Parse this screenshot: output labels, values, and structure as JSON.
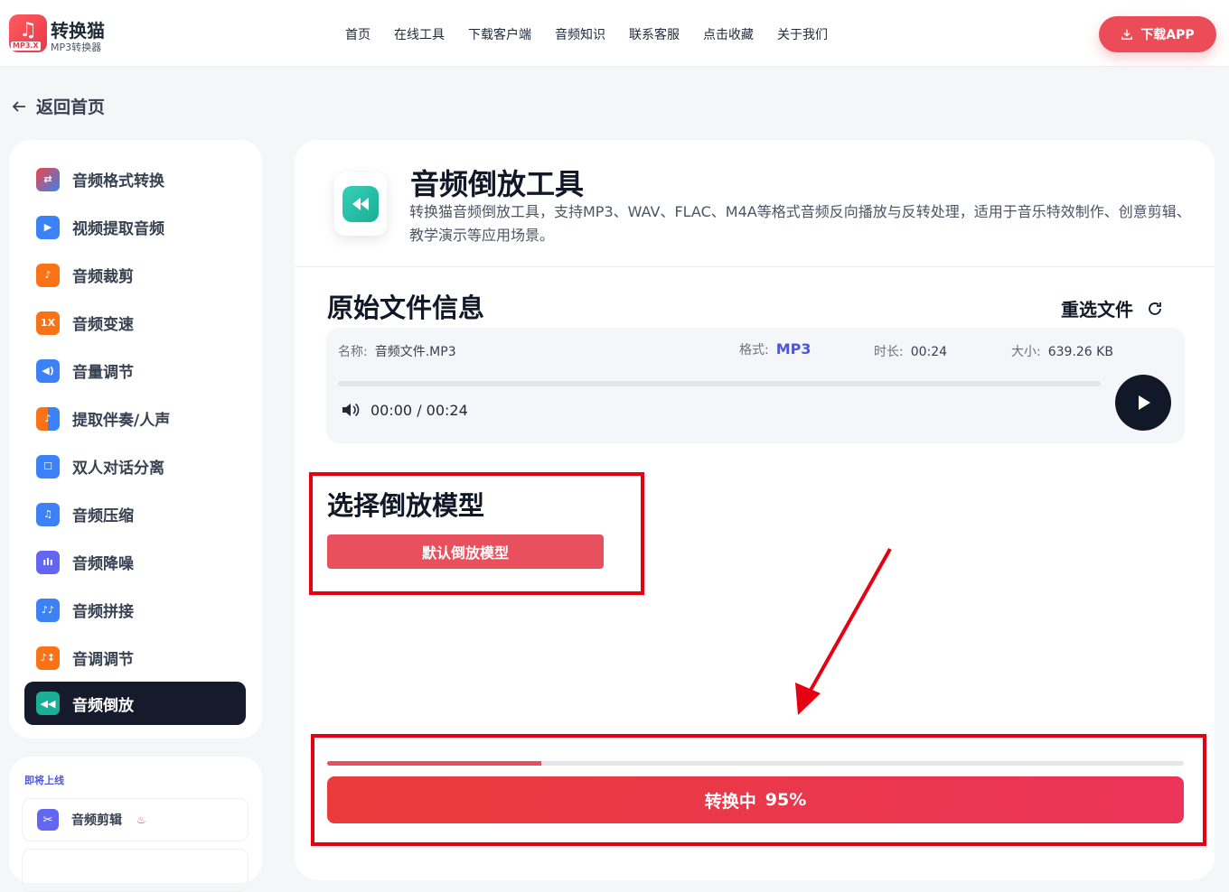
{
  "header": {
    "logo_title": "转换猫",
    "logo_sub": "MP3转换器",
    "logo_badge": "MP3.X",
    "nav": [
      "首页",
      "在线工具",
      "下载客户端",
      "音频知识",
      "联系客服",
      "点击收藏",
      "关于我们"
    ],
    "download_app": "下载APP"
  },
  "back_label": "返回首页",
  "sidebar": {
    "items": [
      {
        "label": "音频格式转换",
        "icon": "format-convert-icon",
        "color": "#ef4444"
      },
      {
        "label": "视频提取音频",
        "icon": "video-extract-icon",
        "color": "#3b82f6"
      },
      {
        "label": "音频裁剪",
        "icon": "audio-cut-icon",
        "color": "#f97316"
      },
      {
        "label": "音频变速",
        "icon": "speed-icon",
        "color": "#f97316",
        "glyph": "1X"
      },
      {
        "label": "音量调节",
        "icon": "volume-icon",
        "color": "#3b82f6"
      },
      {
        "label": "提取伴奏/人声",
        "icon": "vocal-extract-icon",
        "color": "#f97316"
      },
      {
        "label": "双人对话分离",
        "icon": "dialog-split-icon",
        "color": "#3b82f6"
      },
      {
        "label": "音频压缩",
        "icon": "compress-icon",
        "color": "#3b82f6"
      },
      {
        "label": "音频降噪",
        "icon": "denoise-icon",
        "color": "#6366f1"
      },
      {
        "label": "音频拼接",
        "icon": "merge-icon",
        "color": "#3b82f6"
      },
      {
        "label": "音调调节",
        "icon": "pitch-icon",
        "color": "#f97316"
      },
      {
        "label": "音频倒放",
        "icon": "reverse-icon",
        "color": "#1bae97"
      }
    ],
    "active_index": 11
  },
  "soon": {
    "title": "即将上线",
    "items": [
      "音频剪辑"
    ]
  },
  "tool": {
    "title": "音频倒放工具",
    "desc": "转换猫音频倒放工具，支持MP3、WAV、FLAC、M4A等格式音频反向播放与反转处理，适用于音乐特效制作、创意剪辑、教学演示等应用场景。"
  },
  "fileinfo": {
    "section_title": "原始文件信息",
    "reselect": "重选文件",
    "name_key": "名称:",
    "name_val": "音频文件.MP3",
    "format_key": "格式:",
    "format_val": "MP3",
    "duration_key": "时长:",
    "duration_val": "00:24",
    "size_key": "大小:",
    "size_val": "639.26 KB",
    "player_time": "00:00 / 00:24"
  },
  "model": {
    "section_title": "选择倒放模型",
    "default_model": "默认倒放模型"
  },
  "convert": {
    "label": "转换中",
    "percent": "95%",
    "progress": 0.25
  }
}
